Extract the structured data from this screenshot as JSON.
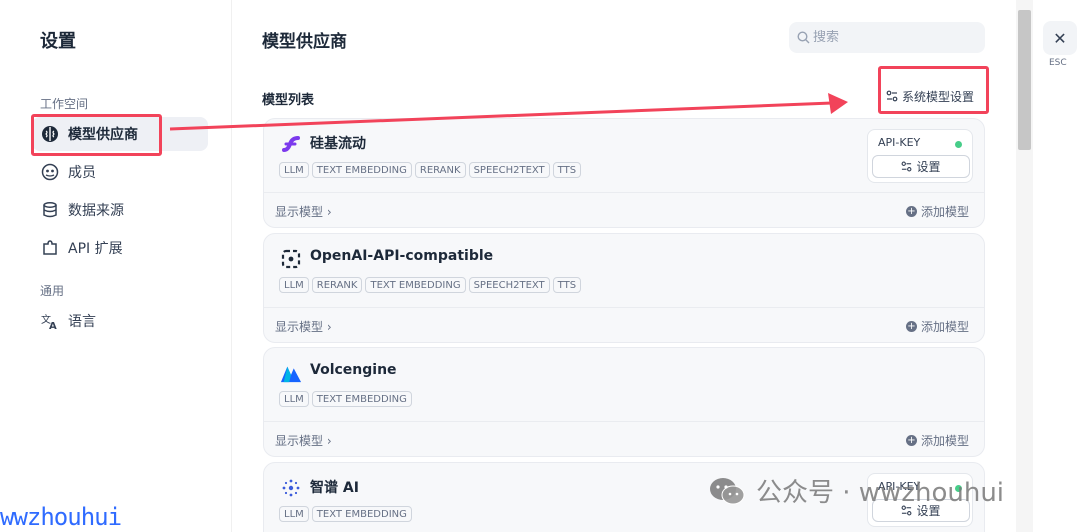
{
  "sidebar": {
    "title": "设置",
    "group_workspace": "工作空间",
    "group_general": "通用",
    "items": [
      {
        "label": "模型供应商",
        "icon": "brain-icon"
      },
      {
        "label": "成员",
        "icon": "members-icon"
      },
      {
        "label": "数据来源",
        "icon": "database-icon"
      },
      {
        "label": "API 扩展",
        "icon": "puzzle-icon"
      },
      {
        "label": "语言",
        "icon": "translate-icon"
      }
    ]
  },
  "main": {
    "title": "模型供应商",
    "search_placeholder": "搜索",
    "section_title": "模型列表",
    "system_settings_label": "系统模型设置",
    "providers": [
      {
        "name": "硅基流动",
        "tags": [
          "LLM",
          "TEXT EMBEDDING",
          "RERANK",
          "SPEECH2TEXT",
          "TTS"
        ],
        "has_api_key": true,
        "api_label": "API-KEY",
        "settings_label": "设置",
        "show_models": "显示模型",
        "add_model": "添加模型"
      },
      {
        "name": "OpenAI-API-compatible",
        "tags": [
          "LLM",
          "RERANK",
          "TEXT EMBEDDING",
          "SPEECH2TEXT",
          "TTS"
        ],
        "has_api_key": false,
        "show_models": "显示模型",
        "add_model": "添加模型"
      },
      {
        "name": "Volcengine",
        "tags": [
          "LLM",
          "TEXT EMBEDDING"
        ],
        "has_api_key": false,
        "show_models": "显示模型",
        "add_model": "添加模型"
      },
      {
        "name": "智谱 AI",
        "tags": [
          "LLM",
          "TEXT EMBEDDING"
        ],
        "has_api_key": true,
        "api_label": "API-KEY",
        "settings_label": "设置"
      }
    ]
  },
  "close": {
    "esc_label": "ESC"
  },
  "watermarks": {
    "left": "wwzhouhui",
    "right": "公众号 · wwzhouhui"
  },
  "colors": {
    "highlight": "#f2435a",
    "status_green": "#47cd89"
  }
}
